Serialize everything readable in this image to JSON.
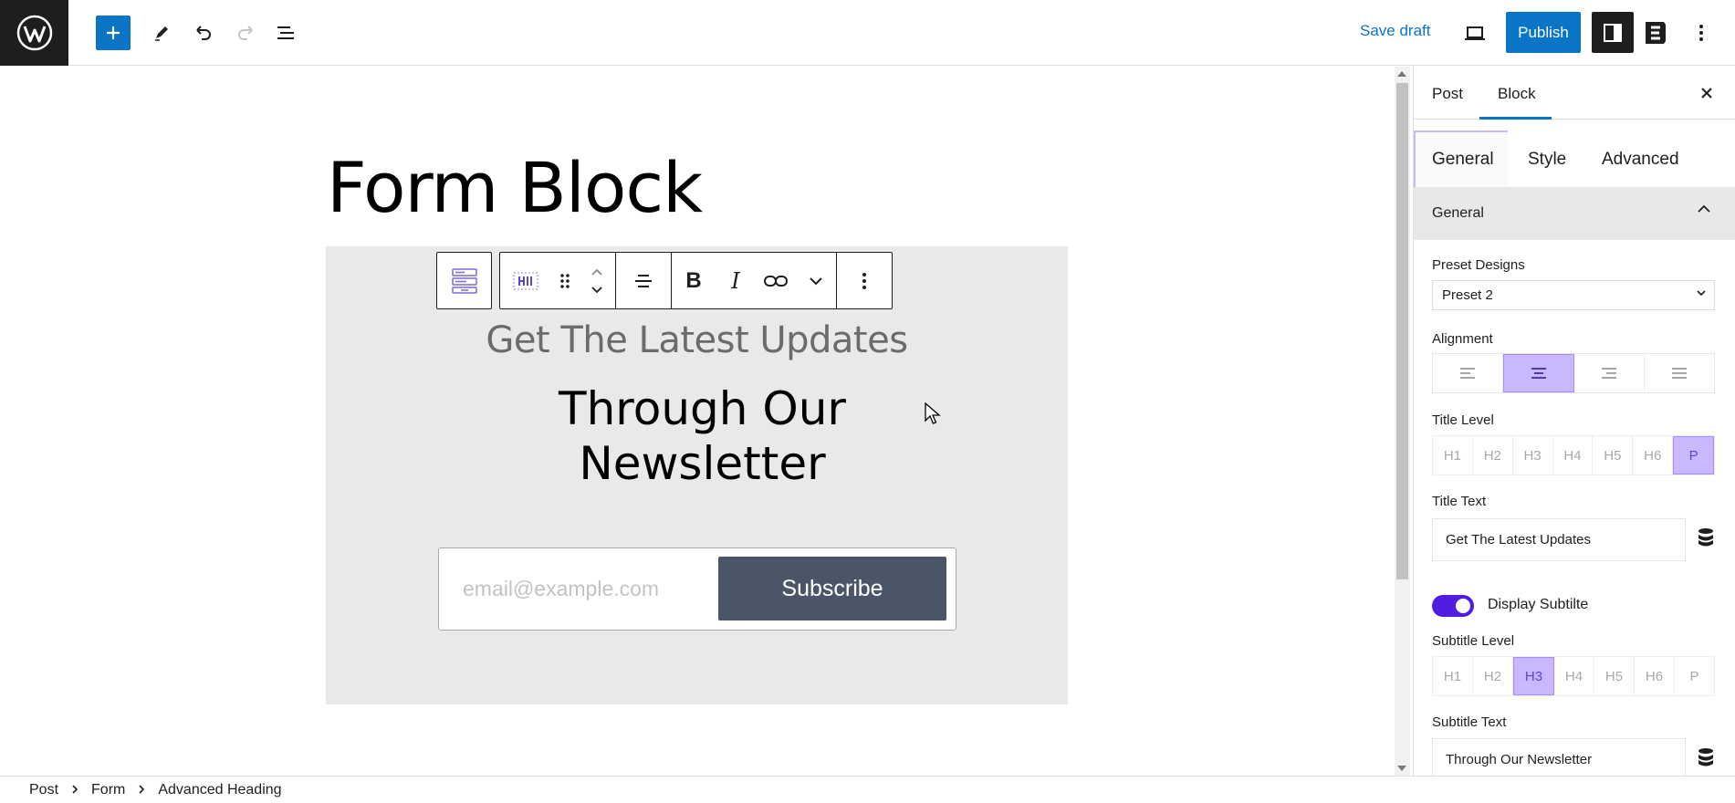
{
  "toolbar": {
    "save_draft_label": "Save draft",
    "publish_label": "Publish"
  },
  "editor": {
    "post_title": "Form Block",
    "form": {
      "subtitle": "Get The Latest Updates",
      "heading_line1": "Through Our",
      "heading_line2": "Newsletter",
      "email_placeholder": "email@example.com",
      "subscribe_label": "Subscribe"
    }
  },
  "sidebar": {
    "tabs": {
      "post": "Post",
      "block": "Block"
    },
    "inner_tabs": {
      "general": "General",
      "style": "Style",
      "advanced": "Advanced"
    },
    "panel_title": "General",
    "preset_label": "Preset Designs",
    "preset_value": "Preset 2",
    "alignment_label": "Alignment",
    "alignment_active": "center",
    "title_level_label": "Title Level",
    "title_levels": [
      "H1",
      "H2",
      "H3",
      "H4",
      "H5",
      "H6",
      "P"
    ],
    "title_level_active": "P",
    "title_text_label": "Title Text",
    "title_text_value": "Get The Latest Updates",
    "display_subtitle_label": "Display Subtilte",
    "display_subtitle_on": true,
    "subtitle_level_label": "Subtitle Level",
    "subtitle_level_active": "H3",
    "subtitle_text_label": "Subtitle Text",
    "subtitle_text_value": "Through Our Newsletter"
  },
  "breadcrumb": [
    "Post",
    "Form",
    "Advanced Heading"
  ],
  "colors": {
    "accent_blue": "#0a74c7",
    "active_purple": "#c9b8ff",
    "toggle_purple": "#4f1ee0",
    "subscribe_bg": "#4a5567"
  }
}
